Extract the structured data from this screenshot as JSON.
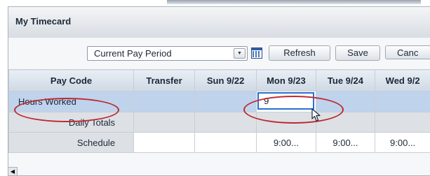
{
  "panel": {
    "title": "My Timecard"
  },
  "toolbar": {
    "period_select": {
      "value": "Current Pay Period"
    },
    "refresh_label": "Refresh",
    "save_label": "Save",
    "cancel_label": "Canc"
  },
  "grid": {
    "headers": [
      "Pay Code",
      "Transfer",
      "Sun 9/22",
      "Mon 9/23",
      "Tue 9/24",
      "Wed 9/2"
    ],
    "rows": [
      {
        "label": "Hours Worked",
        "values": [
          "",
          "",
          "9",
          "",
          ""
        ]
      },
      {
        "label": "Daily Totals",
        "values": [
          "",
          "",
          "",
          "",
          ""
        ]
      },
      {
        "label": "Schedule",
        "values": [
          "",
          "",
          "9:00...",
          "9:00...",
          "9:00..."
        ]
      }
    ]
  },
  "annotation_colors": {
    "highlight_ellipse": "#c0282e",
    "active_input_border": "#2a6fd0"
  }
}
